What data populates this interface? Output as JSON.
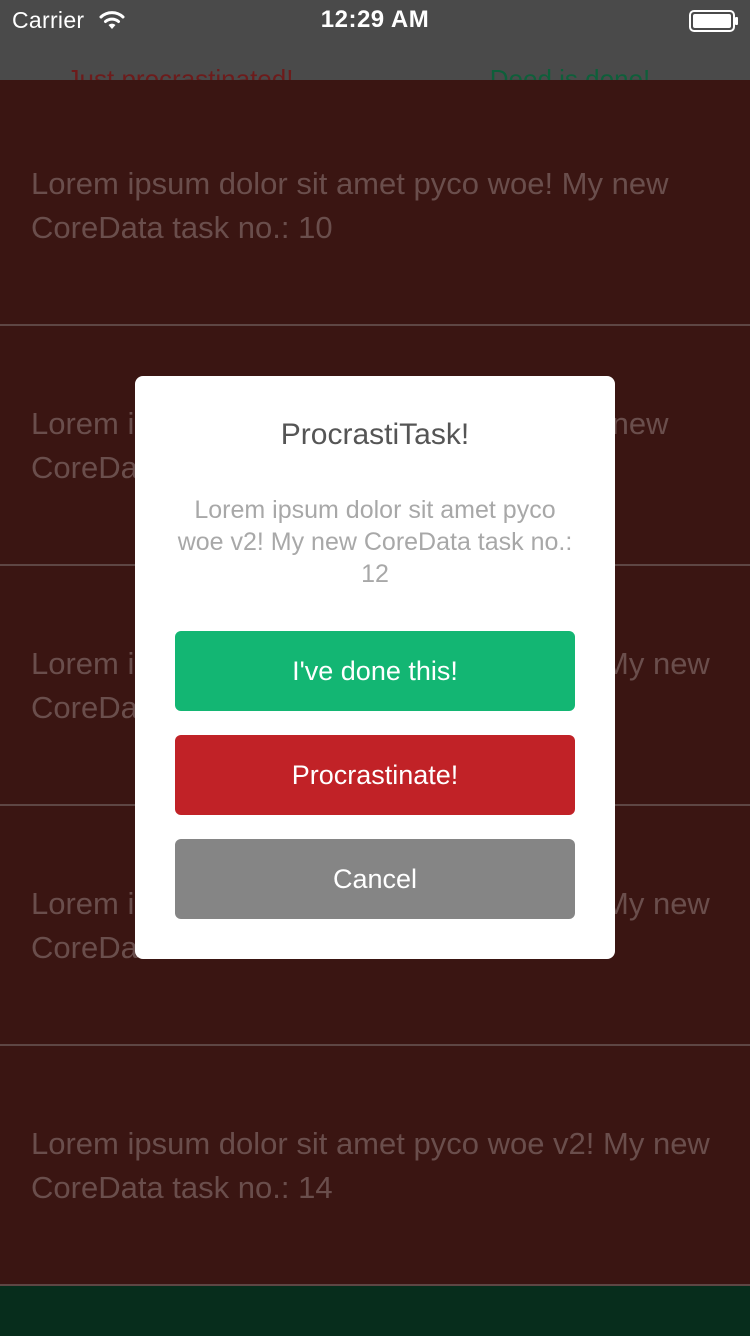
{
  "status_bar": {
    "carrier": "Carrier",
    "time": "12:29 AM",
    "wifi_icon": "wifi-icon",
    "battery_icon": "battery-icon"
  },
  "header": {
    "left_action": "Just procrastinated!",
    "right_action": "Deed is done!",
    "left_action_color": "#6d1b1b",
    "right_action_color": "#0e5f3a"
  },
  "task_list": {
    "rows": [
      {
        "text": "Lorem ipsum dolor sit amet pyco woe! My new CoreData task no.: 10"
      },
      {
        "text": "Lorem ipsum dolor sit amet pyco woe! My new CoreData task no.: 11"
      },
      {
        "text": "Lorem ipsum dolor sit amet pyco woe v2! My new CoreData task no.: 12"
      },
      {
        "text": "Lorem ipsum dolor sit amet pyco woe v2! My new CoreData task no.: 13"
      },
      {
        "text": "Lorem ipsum dolor sit amet pyco woe v2! My new CoreData task no.: 14"
      }
    ]
  },
  "alert": {
    "title": "ProcrastiTask!",
    "message": "Lorem ipsum dolor sit amet pyco woe v2! My new CoreData task no.: 12",
    "buttons": {
      "done": "I've done this!",
      "procrastinate": "Procrastinate!",
      "cancel": "Cancel"
    }
  },
  "colors": {
    "done_green": "#13b673",
    "procrastinate_red": "#c12227",
    "cancel_gray": "#858585",
    "row_background": "#3a1512",
    "header_background": "#4a4a4a",
    "footer_background": "#072d1c"
  }
}
